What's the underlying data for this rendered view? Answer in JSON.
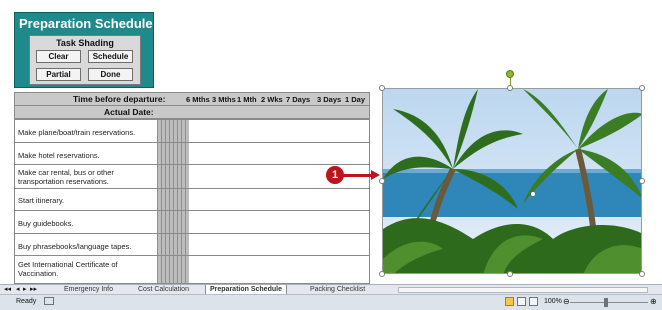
{
  "panel": {
    "title": "Preparation Schedule",
    "shading_label": "Task Shading",
    "buttons": {
      "clear": "Clear",
      "schedule": "Schedule",
      "partial": "Partial",
      "done": "Done"
    }
  },
  "header": {
    "time_label": "Time before departure:",
    "columns": [
      "6 Mths",
      "3 Mths",
      "1 Mth",
      "2 Wks",
      "7 Days",
      "3 Days",
      "1 Day"
    ],
    "actual_label": "Actual Date:"
  },
  "tasks": [
    "Make plane/boat/train reservations.",
    "Make hotel reservations.",
    "Make car rental, bus or other transportation reservations.",
    "Start itinerary.",
    "Buy guidebooks.",
    "Buy phrasebooks/language tapes.",
    "Get International Certificate of Vaccination."
  ],
  "callout": {
    "number": "1"
  },
  "sheet_tabs": [
    "Emergency Info",
    "Cost Calculation",
    "Preparation Schedule",
    "Packing Checklist"
  ],
  "active_tab": "Preparation Schedule",
  "status": {
    "ready": "Ready",
    "zoom": "100%"
  },
  "icons": {
    "nav_first": "first-sheet-icon",
    "nav_prev": "prev-sheet-icon",
    "nav_next": "next-sheet-icon",
    "nav_last": "last-sheet-icon",
    "normal_view": "normal-view-icon",
    "page_layout": "page-layout-icon",
    "page_break": "page-break-icon",
    "zoom_out": "zoom-out-icon",
    "zoom_in": "zoom-in-icon"
  },
  "colors": {
    "panel_bg": "#1f8a8c",
    "callout": "#c0141c"
  }
}
